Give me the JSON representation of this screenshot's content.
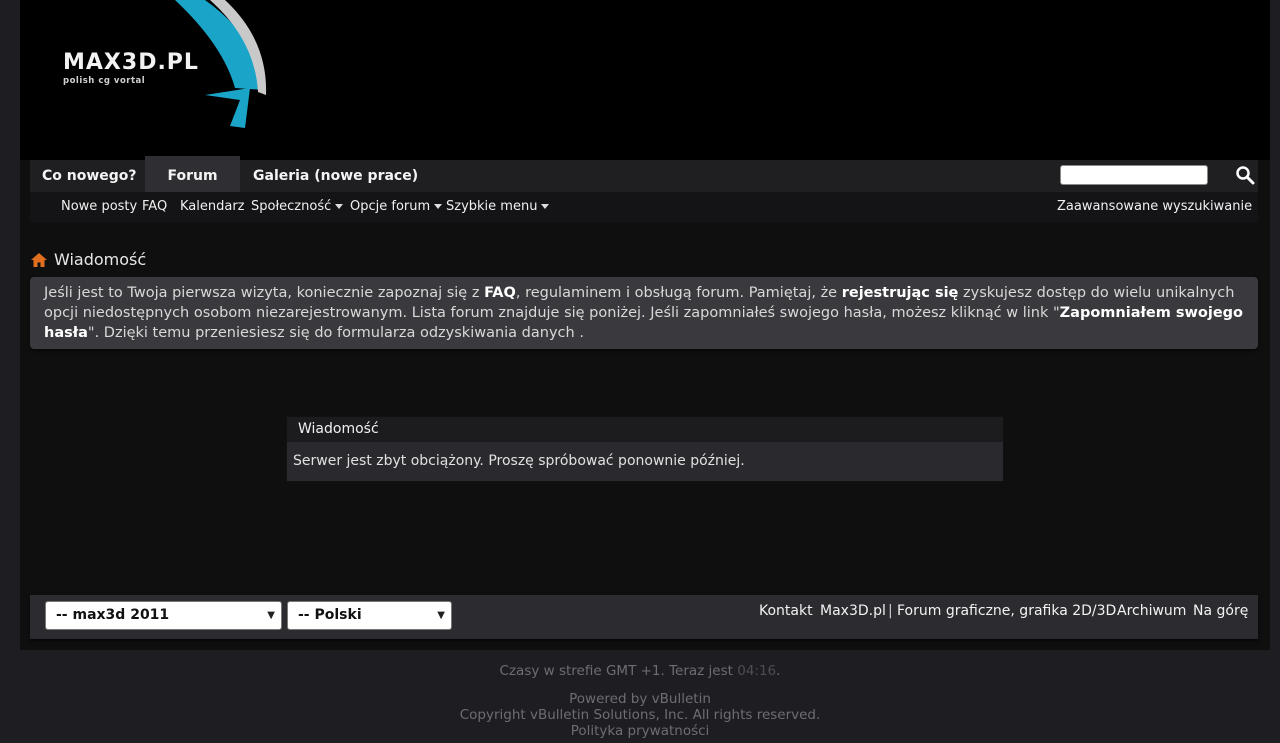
{
  "logo": {
    "name": "MAX3D.PL",
    "tagline": "polish cg vortal"
  },
  "nav": {
    "tabs": [
      {
        "label": "Co nowego?"
      },
      {
        "label": "Forum",
        "active": true
      },
      {
        "label": "Galeria (nowe prace)"
      }
    ],
    "search_value": ""
  },
  "subnav": {
    "items": [
      "Nowe posty",
      "FAQ",
      "Kalendarz",
      "Społeczność",
      "Opcje forum",
      "Szybkie menu"
    ],
    "advanced_search": "Zaawansowane wyszukiwanie"
  },
  "breadcrumb": {
    "current": "Wiadomość"
  },
  "notice": {
    "p1": "Jeśli jest to Twoja pierwsza wizyta, koniecznie zapoznaj się z ",
    "faq": "FAQ",
    "p2": ", regulaminem i obsługą forum. Pamiętaj, że ",
    "register": "rejestrując się",
    "p3": " zyskujesz dostęp do wielu unikalnych opcji niedostępnych osobom niezarejestrowanym. Lista forum znajduje się poniżej. Jeśli zapomniałeś swojego hasła, możesz kliknąć w link \"",
    "forgot": "Zapomniałem swojego hasła",
    "p4": "\". Dzięki temu przeniesiesz się do formularza odzyskiwania danych ."
  },
  "message": {
    "title": "Wiadomość",
    "body": "Serwer jest zbyt obciążony. Proszę spróbować ponownie później."
  },
  "footer": {
    "style_select": "-- max3d 2011",
    "lang_select": "-- Polski",
    "links": {
      "contact": "Kontakt",
      "site": "Max3D.pl",
      "sep": "|",
      "forum": "Forum graficzne, grafika 2D/3D",
      "archive": "Archiwum",
      "top": "Na górę"
    }
  },
  "bottom": {
    "tz": "Czasy w strefie GMT +1. Teraz jest ",
    "time": "04:16",
    "dot": ".",
    "powered": "Powered by vBulletin",
    "copyright": "Copyright vBulletin Solutions, Inc. All rights reserved.",
    "privacy": "Polityka prywatności"
  },
  "colors": {
    "accent": "#1aa5c8",
    "home_icon": "#e07020"
  }
}
